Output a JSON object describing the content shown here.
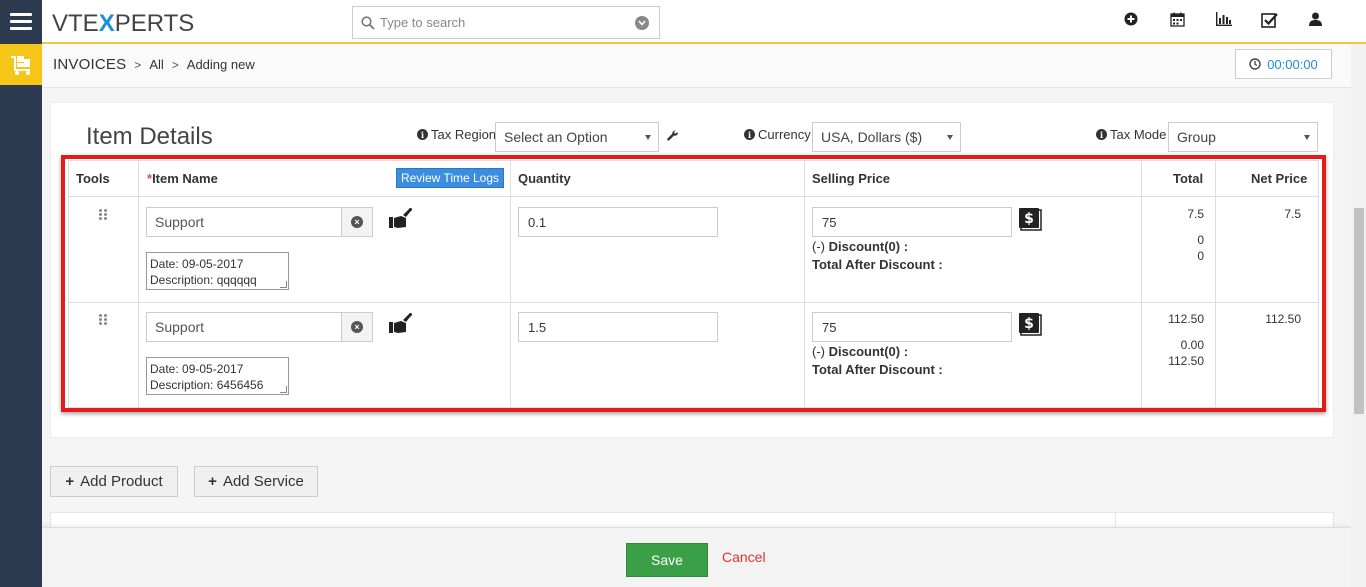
{
  "brand": {
    "logo_pre": "VTE",
    "logo_x": "X",
    "logo_post": "PERTS"
  },
  "search": {
    "placeholder": "Type to search"
  },
  "topbar_icons": [
    "plus-circle-icon",
    "calendar-icon",
    "bar-chart-icon",
    "checkbox-icon",
    "user-icon"
  ],
  "breadcrumb": {
    "module": "INVOICES",
    "filter": "All",
    "action": "Adding new"
  },
  "timer": {
    "value": "00:00:00"
  },
  "section": {
    "title": "Item Details"
  },
  "fields": {
    "tax_region": {
      "label": "Tax Region",
      "value": "Select an Option"
    },
    "currency": {
      "label": "Currency",
      "value": "USA, Dollars ($)"
    },
    "tax_mode": {
      "label": "Tax Mode",
      "value": "Group"
    }
  },
  "table": {
    "headers": {
      "tools": "Tools",
      "item_name": "Item Name",
      "required_mark": "*",
      "review_btn": "Review Time Logs",
      "quantity": "Quantity",
      "selling_price": "Selling Price",
      "total": "Total",
      "net_price": "Net Price"
    },
    "discount_prefix": "(-) ",
    "discount_label": "Discount(0) :",
    "total_after_discount": "Total After Discount :",
    "rows": [
      {
        "name": "Support",
        "desc_line1": "Date: 09-05-2017",
        "desc_line2": "Description: qqqqqq",
        "quantity": "0.1",
        "price": "75",
        "total": "7.5",
        "discount": "0",
        "after_discount": "0",
        "net": "7.5"
      },
      {
        "name": "Support",
        "desc_line1": "Date: 09-05-2017",
        "desc_line2": "Description: 6456456",
        "quantity": "1.5",
        "price": "75",
        "total": "112.50",
        "discount": "0.00",
        "after_discount": "112.50",
        "net": "112.50"
      }
    ]
  },
  "actions": {
    "add_product": "Add Product",
    "add_service": "Add Service",
    "save": "Save",
    "cancel": "Cancel"
  },
  "colors": {
    "accent": "#1c8fd6",
    "highlight": "#e41b1b",
    "save": "#3a9f47",
    "module": "#f5c518",
    "rail": "#2c3b4f"
  }
}
